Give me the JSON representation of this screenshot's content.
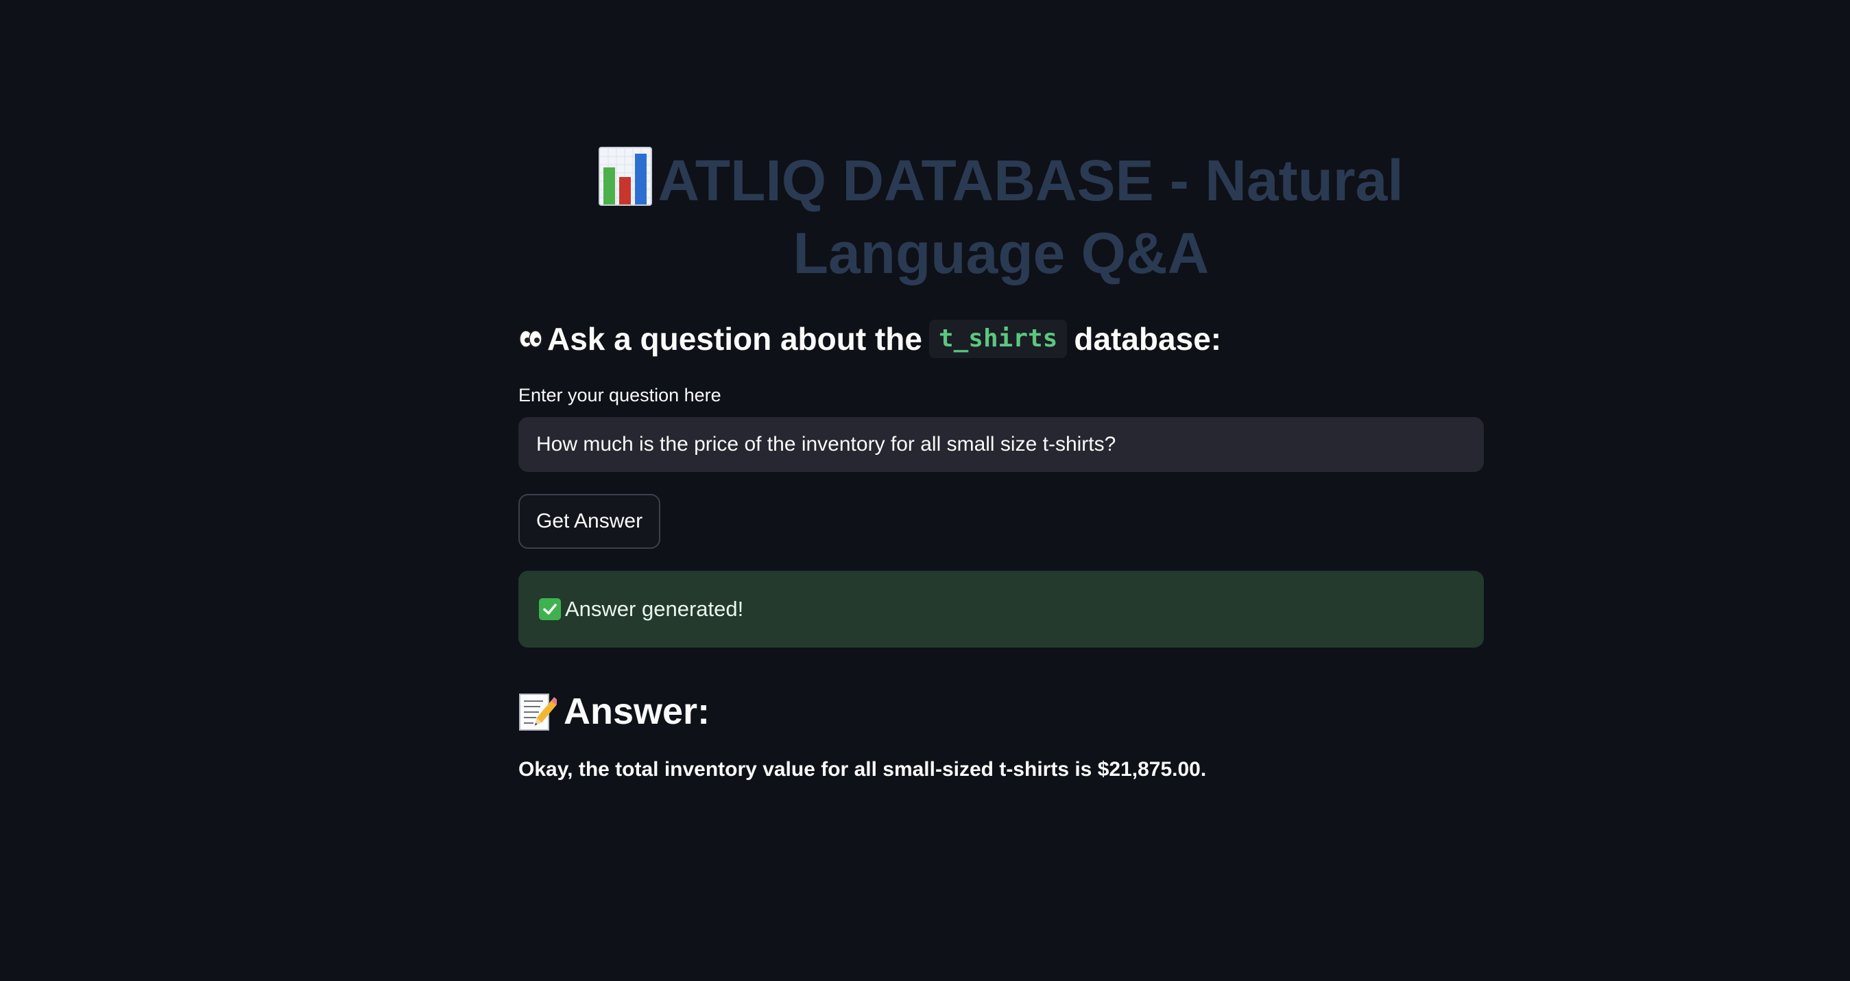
{
  "app": {
    "title": "ATLIQ DATABASE - Natural Language Q&A",
    "title_icon": "bar-chart-emoji"
  },
  "prompt": {
    "prefix": "Ask a question about the",
    "table_name": "t_shirts",
    "suffix": "database:",
    "icon": "eyes-emoji"
  },
  "question": {
    "label": "Enter your question here",
    "value": "How much is the price of the inventory for all small size t-shirts?"
  },
  "actions": {
    "get_answer_label": "Get Answer"
  },
  "status": {
    "message": "Answer generated!",
    "icon": "check-mark-emoji"
  },
  "answer": {
    "header": "Answer:",
    "icon": "memo-emoji",
    "text": "Okay, the total inventory value for all small-sized t-shirts is $21,875.00."
  },
  "colors": {
    "background": "#0e1117",
    "title": "#2a3a52",
    "code": "#5cc77f",
    "success_bg": "#233a2c",
    "input_bg": "#262730"
  }
}
